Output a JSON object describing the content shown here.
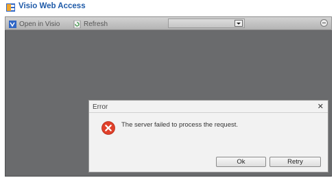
{
  "app": {
    "title": "Visio Web Access",
    "icon": "visio-app-icon"
  },
  "toolbar": {
    "open_label": "Open in Visio",
    "refresh_label": "Refresh",
    "dropdown_value": "",
    "zoom_icon": "zoom-out-icon"
  },
  "dialog": {
    "title": "Error",
    "close_label": "✕",
    "message": "The server failed to process the request.",
    "ok_label": "Ok",
    "retry_label": "Retry",
    "icon": "error-icon"
  },
  "colors": {
    "accent": "#1e5aa8",
    "canvas": "#6a6b6d",
    "error": "#e0402a"
  }
}
